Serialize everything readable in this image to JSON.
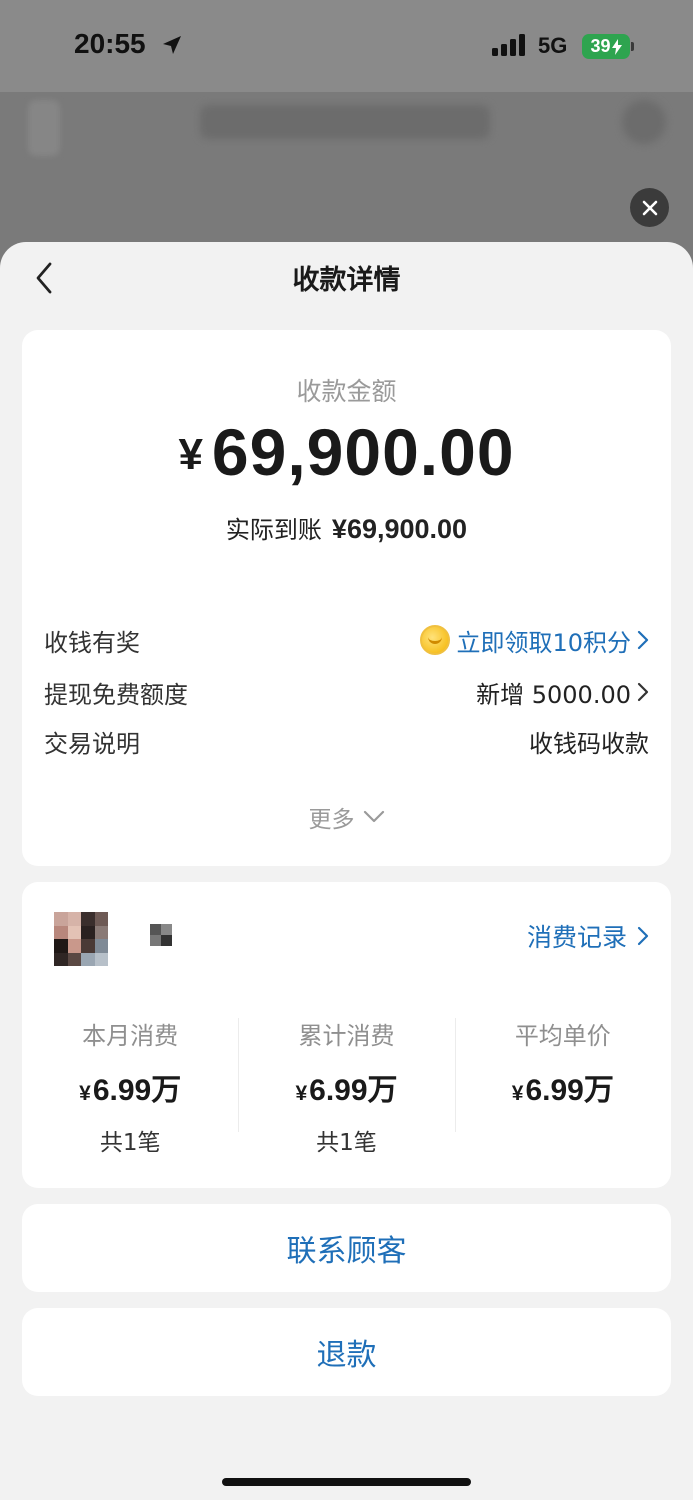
{
  "status_bar": {
    "time": "20:55",
    "network": "5G",
    "battery": "39"
  },
  "sheet": {
    "title": "收款详情"
  },
  "amount": {
    "label": "收款金额",
    "currency": "¥",
    "value": "69,900.00",
    "received_label": "实际到账",
    "received_value": "¥69,900.00"
  },
  "details": [
    {
      "label": "收钱有奖",
      "value": "立即领取10积分"
    },
    {
      "label": "提现免费额度",
      "value": "新增 5000.00"
    },
    {
      "label": "交易说明",
      "value": "收钱码收款"
    }
  ],
  "more_label": "更多",
  "customer": {
    "records_label": "消费记录",
    "stats": [
      {
        "label": "本月消费",
        "currency": "¥",
        "value": "6.99万",
        "count": "共1笔"
      },
      {
        "label": "累计消费",
        "currency": "¥",
        "value": "6.99万",
        "count": "共1笔"
      },
      {
        "label": "平均单价",
        "currency": "¥",
        "value": "6.99万",
        "count": ""
      }
    ]
  },
  "actions": {
    "contact_label": "联系顾客",
    "refund_label": "退款"
  },
  "colors": {
    "link": "#1f6fb8",
    "battery": "#2ea44f",
    "overlay": "#7a7a7a"
  }
}
